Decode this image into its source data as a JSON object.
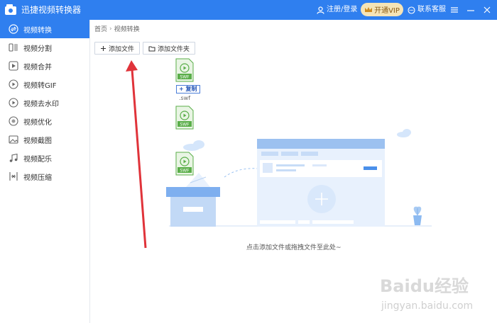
{
  "app": {
    "title": "迅捷视频转换器",
    "login_label": "注册/登录",
    "vip_label": "开通VIP",
    "support_label": "联系客服",
    "brand_color": "#2f7fef"
  },
  "sidebar": {
    "items": [
      {
        "label": "视频转换",
        "icon": "convert-icon"
      },
      {
        "label": "视频分割",
        "icon": "split-icon"
      },
      {
        "label": "视频合并",
        "icon": "merge-icon"
      },
      {
        "label": "视频转GIF",
        "icon": "gif-icon"
      },
      {
        "label": "视频去水印",
        "icon": "watermark-icon"
      },
      {
        "label": "视频优化",
        "icon": "optimize-icon"
      },
      {
        "label": "视频截图",
        "icon": "screenshot-icon"
      },
      {
        "label": "视频配乐",
        "icon": "music-icon"
      },
      {
        "label": "视频压缩",
        "icon": "compress-icon"
      }
    ]
  },
  "breadcrumb": {
    "home": "首页",
    "current": "视频转换"
  },
  "toolbar": {
    "add_file": "添加文件",
    "add_folder": "添加文件夹"
  },
  "drop_area": {
    "hint": "点击添加文件或拖拽文件至此处~"
  },
  "files": [
    {
      "type": "SWF",
      "name_line1": "",
      "name_line2": ".swf"
    },
    {
      "type": "SWF",
      "name_line1": "",
      "name_line2": ""
    },
    {
      "type": "SWF",
      "name_line1": "",
      "name_line2": ""
    }
  ],
  "drag_badge": "+ 复制",
  "watermark": {
    "brand": "Baidu经验",
    "url": "jingyan.baidu.com"
  }
}
